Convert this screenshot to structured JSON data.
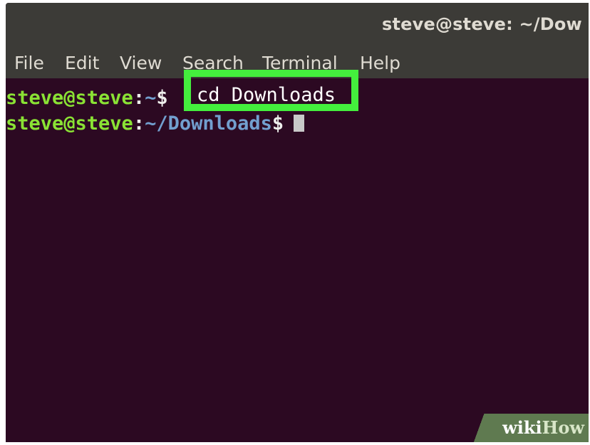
{
  "window": {
    "title": "steve@steve: ~/Dow"
  },
  "menu": {
    "items": [
      "File",
      "Edit",
      "View",
      "Search",
      "Terminal",
      "Help"
    ]
  },
  "terminal": {
    "line1": {
      "user": "steve@steve",
      "sep": ":",
      "path": "~",
      "dollar": "$",
      "command": "cd Downloads"
    },
    "line2": {
      "user": "steve@steve",
      "sep": ":",
      "path": "~/Downloads",
      "dollar": "$"
    }
  },
  "highlight": {
    "color": "#44ef3d",
    "text": "cd Downloads"
  },
  "watermark": {
    "wiki": "wiki",
    "how": "How"
  },
  "colors": {
    "terminal_bg": "#2c0922",
    "titlebar_bg": "#3c3b37",
    "prompt_green": "#8ae234",
    "prompt_blue": "#729fcf"
  }
}
